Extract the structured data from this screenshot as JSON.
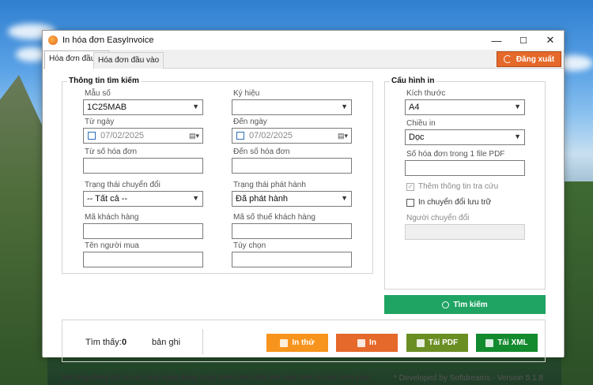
{
  "window": {
    "title": "In hóa đơn EasyInvoice"
  },
  "titlebar_buttons": {
    "minimize": "—",
    "maximize": "☐",
    "close": "✕"
  },
  "tabs": [
    {
      "label": "Hóa đơn đầu ra",
      "active": true
    },
    {
      "label": "Hóa đơn đầu vào",
      "active": false
    }
  ],
  "logout_label": "Đăng xuất",
  "search_group": {
    "title": "Thông tin tìm kiếm",
    "template_label": "Mẫu số",
    "template_value": "1C25MAB",
    "symbol_label": "Ký hiệu",
    "symbol_value": "",
    "from_date_label": "Từ ngày",
    "from_date_value": "07/02/2025",
    "to_date_label": "Đến ngày",
    "to_date_value": "07/02/2025",
    "from_no_label": "Từ số hóa đơn",
    "from_no_value": "",
    "to_no_label": "Đến số hóa đơn",
    "to_no_value": "",
    "convert_status_label": "Trạng thái chuyển đổi",
    "convert_status_value": "-- Tất cả --",
    "issue_status_label": "Trạng thái phát hành",
    "issue_status_value": "Đã phát hành",
    "customer_code_label": "Mã khách hàng",
    "customer_code_value": "",
    "customer_tax_label": "Mã số thuế khách hàng",
    "customer_tax_value": "",
    "buyer_label": "Tên người mua",
    "buyer_value": "",
    "option_label": "Tùy chọn",
    "option_value": ""
  },
  "print_config": {
    "title": "Cấu hình in",
    "size_label": "Kích thước",
    "size_value": "A4",
    "orientation_label": "Chiều in",
    "orientation_value": "Dọc",
    "per_pdf_label": "Số hóa đơn trong 1 file PDF",
    "per_pdf_value": "",
    "add_lookup_label": "Thêm thông tin tra cứu",
    "add_lookup_checked": true,
    "print_archive_label": "In chuyển đổi lưu trữ",
    "print_archive_checked": false,
    "converter_label": "Người chuyển đổi",
    "converter_value": ""
  },
  "search_button_label": "Tìm kiếm",
  "results": {
    "found_label": "Tìm thấy:",
    "count": "0",
    "unit": "bản ghi"
  },
  "actions": {
    "print_test": "In thử",
    "print": "In",
    "download_pdf": "Tải PDF",
    "download_xml": "Tải XML"
  },
  "colors": {
    "print_test": "#f7941d",
    "print": "#e5692a",
    "download_pdf": "#6b8e23",
    "download_xml": "#138a2e",
    "search": "#1fa463",
    "logout": "#e5692a"
  },
  "footer": {
    "note": "Vui lòng đóng tất cả các ứng dụng đang chạy trước khi in/tải với máy tính có cấu hình yếu!",
    "version": "* Developed by Softdreams - Version 5.1.8"
  }
}
